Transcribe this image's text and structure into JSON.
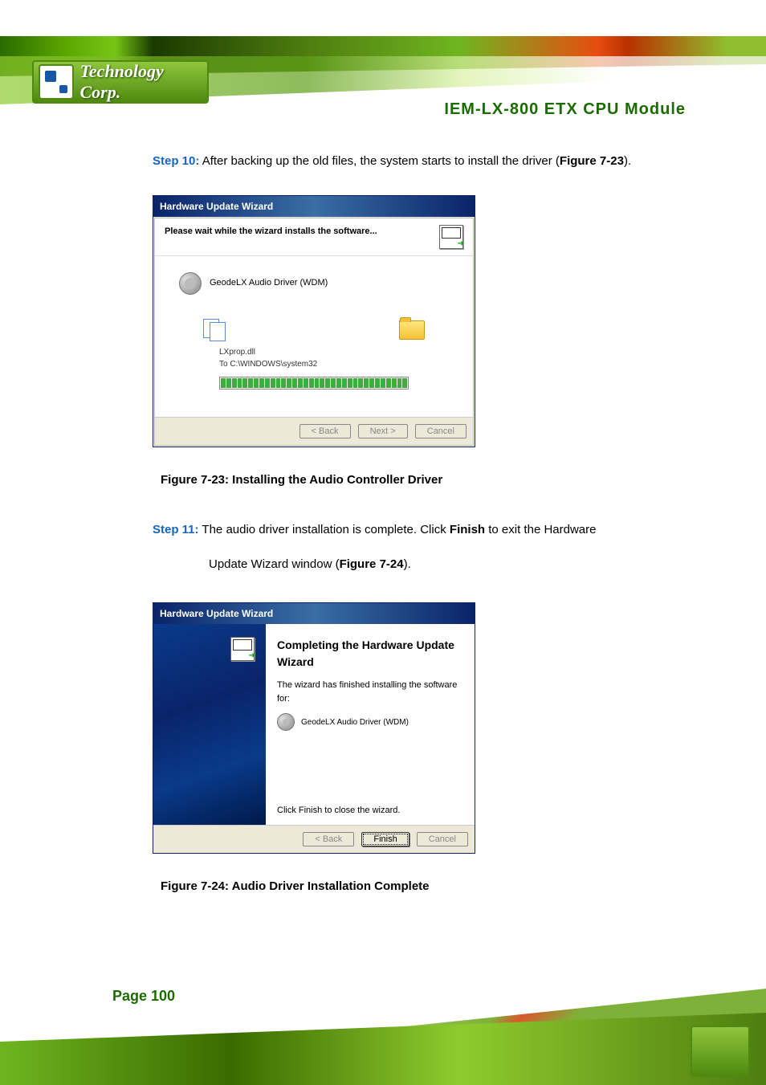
{
  "header": {
    "logo_text": "Technology Corp.",
    "doc_title": "IEM-LX-800  ETX  CPU  Module"
  },
  "step10": {
    "label": "Step 10:",
    "text_before": " After backing up the old files, the system starts to install the driver (",
    "figure_ref": "Figure 7-23",
    "text_after": ")."
  },
  "dialog1": {
    "title": "Hardware Update Wizard",
    "head_text": "Please wait while the wizard installs the software...",
    "driver_name": "GeodeLX Audio Driver (WDM)",
    "file_name": "LXprop.dll",
    "file_dest": "To C:\\WINDOWS\\system32",
    "btn_back": "< Back",
    "btn_next": "Next >",
    "btn_cancel": "Cancel"
  },
  "caption1": "Figure 7-23: Installing the Audio Controller Driver",
  "step11": {
    "label": "Step 11:",
    "text_before": " The audio driver installation is complete. Click ",
    "bold1": "Finish",
    "text_mid": " to exit the Hardware",
    "line2_before": "Update Wizard window (",
    "figure_ref": "Figure 7-24",
    "line2_after": ")."
  },
  "dialog2": {
    "title": "Hardware Update Wizard",
    "heading": "Completing the Hardware Update Wizard",
    "subtext": "The wizard has finished installing the software for:",
    "driver_name": "GeodeLX Audio Driver (WDM)",
    "close_text": "Click Finish to close the wizard.",
    "btn_back": "< Back",
    "btn_finish": "Finish",
    "btn_cancel": "Cancel"
  },
  "caption2": "Figure 7-24: Audio Driver Installation Complete",
  "footer": {
    "page_label": "Page 100"
  }
}
